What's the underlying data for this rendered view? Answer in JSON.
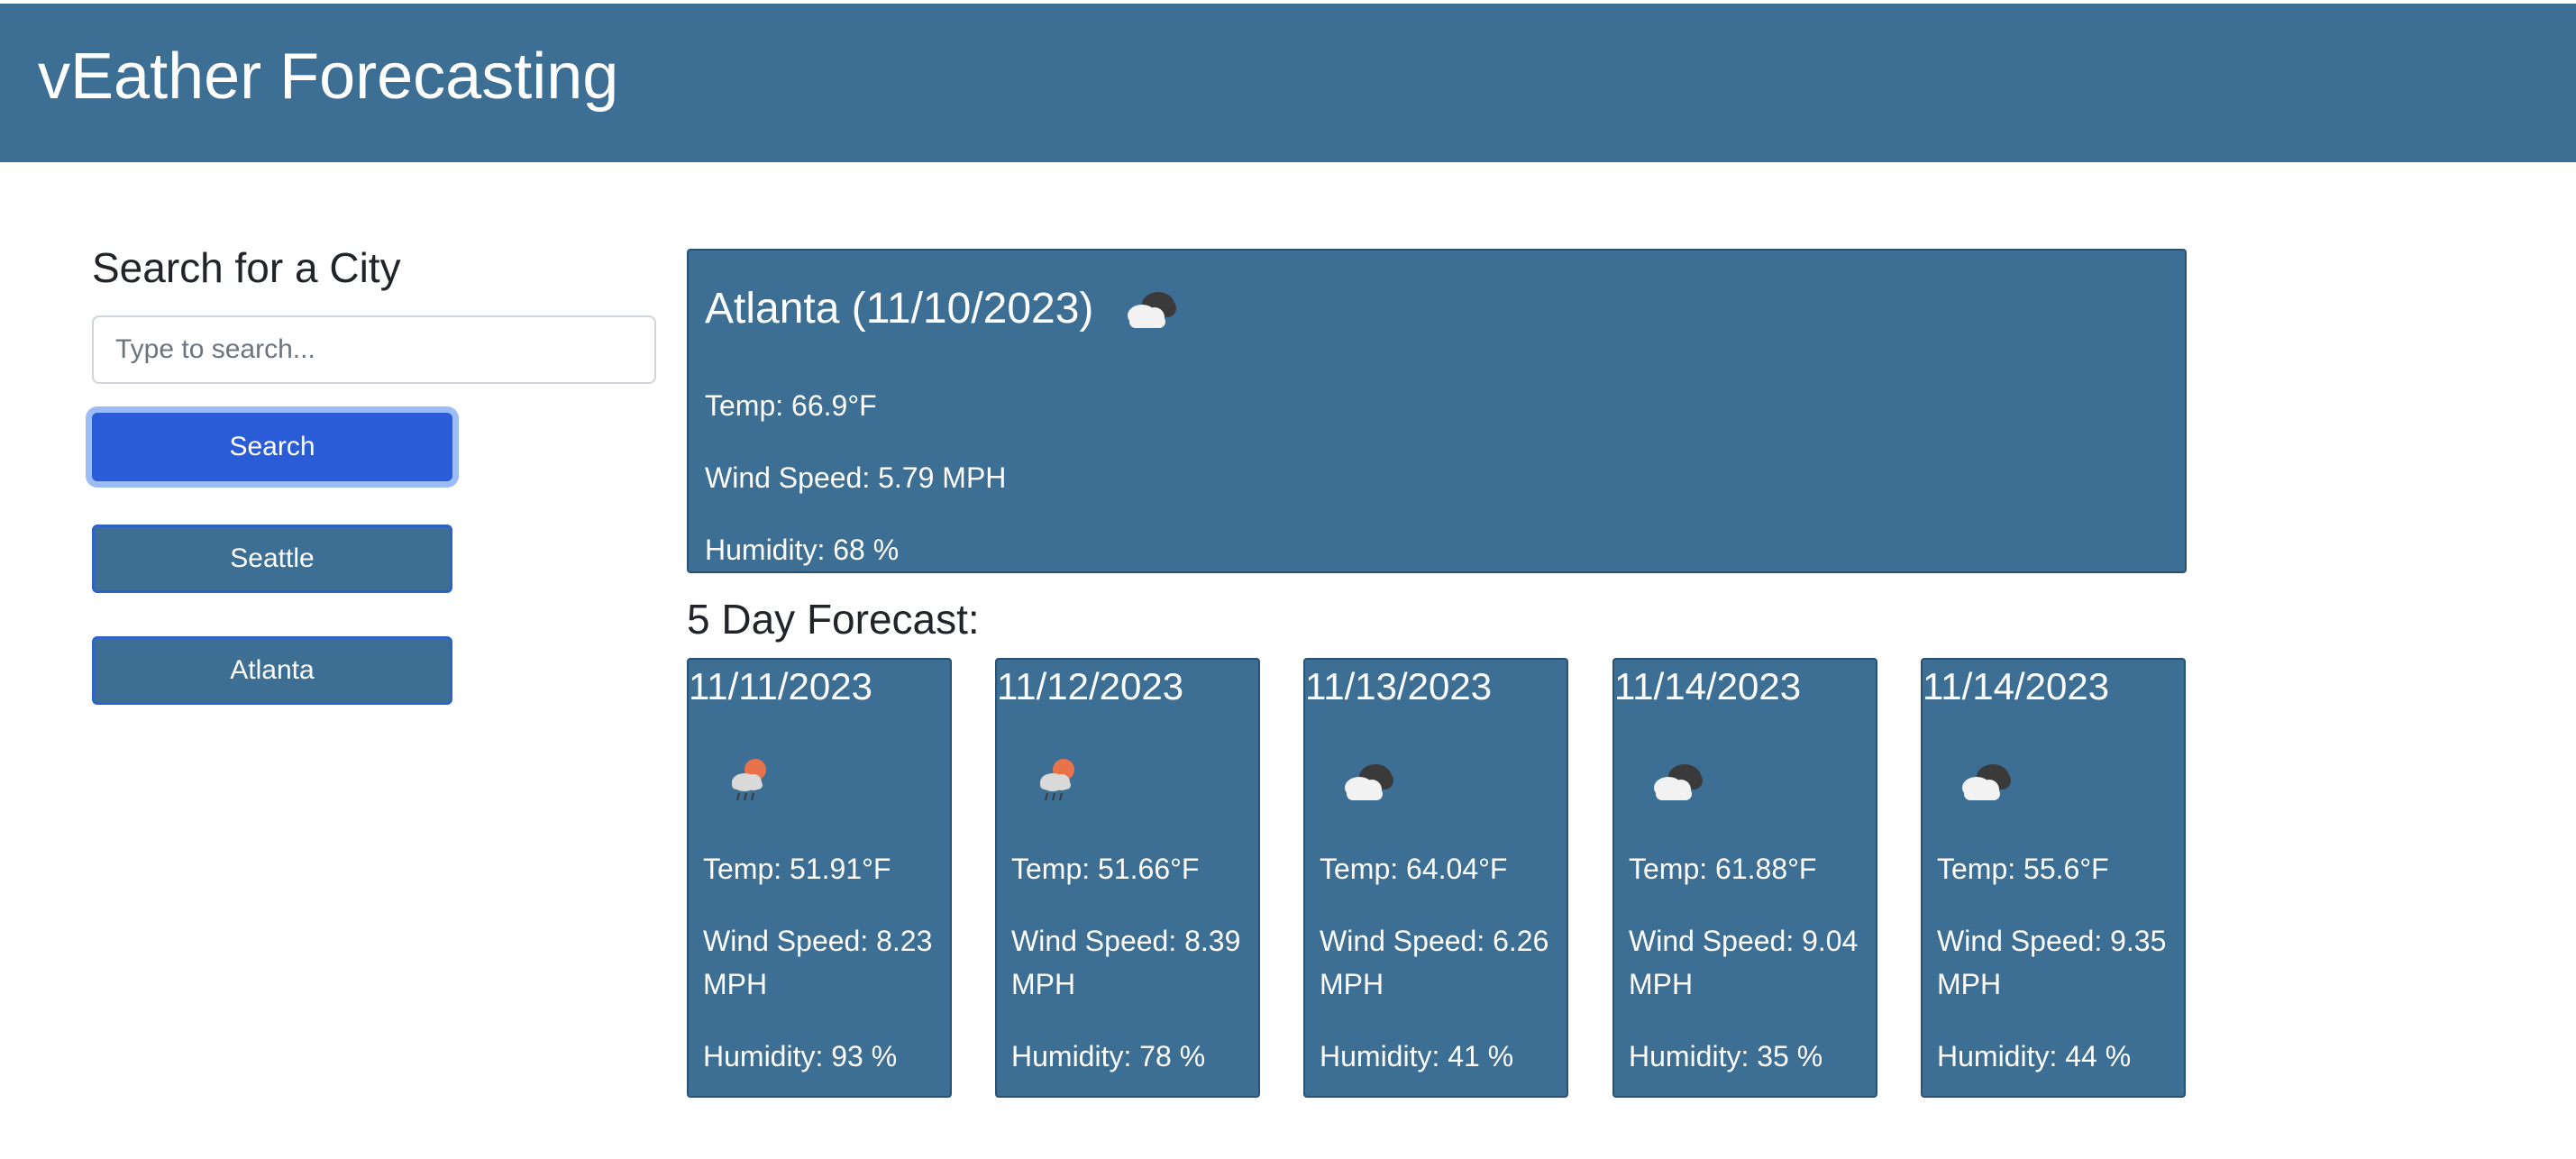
{
  "header": {
    "title": "vEather Forecasting"
  },
  "sidebar": {
    "heading": "Search for a City",
    "search_placeholder": "Type to search...",
    "search_button": "Search",
    "history": [
      "Seattle",
      "Atlanta"
    ]
  },
  "current": {
    "title": "Atlanta (11/10/2023)",
    "icon": "cloudy-icon",
    "temp": "Temp: 66.9°F",
    "wind": "Wind Speed: 5.79 MPH",
    "humidity": "Humidity: 68 %"
  },
  "forecast": {
    "heading": "5 Day Forecast:",
    "days": [
      {
        "date": "11/11/2023",
        "icon": "rain-sun-icon",
        "temp": "Temp: 51.91°F",
        "wind": "Wind Speed: 8.23 MPH",
        "humidity": "Humidity: 93 %"
      },
      {
        "date": "11/12/2023",
        "icon": "rain-sun-icon",
        "temp": "Temp: 51.66°F",
        "wind": "Wind Speed: 8.39 MPH",
        "humidity": "Humidity: 78 %"
      },
      {
        "date": "11/13/2023",
        "icon": "cloudy-icon",
        "temp": "Temp: 64.04°F",
        "wind": "Wind Speed: 6.26 MPH",
        "humidity": "Humidity: 41 %"
      },
      {
        "date": "11/14/2023",
        "icon": "cloudy-icon",
        "temp": "Temp: 61.88°F",
        "wind": "Wind Speed: 9.04 MPH",
        "humidity": "Humidity: 35 %"
      },
      {
        "date": "11/14/2023",
        "icon": "cloudy-icon",
        "temp": "Temp: 55.6°F",
        "wind": "Wind Speed: 9.35 MPH",
        "humidity": "Humidity: 44 %"
      }
    ]
  },
  "colors": {
    "panel": "#3d6f94",
    "search_button": "#2b5cd8",
    "history_border": "#2d63c8"
  }
}
